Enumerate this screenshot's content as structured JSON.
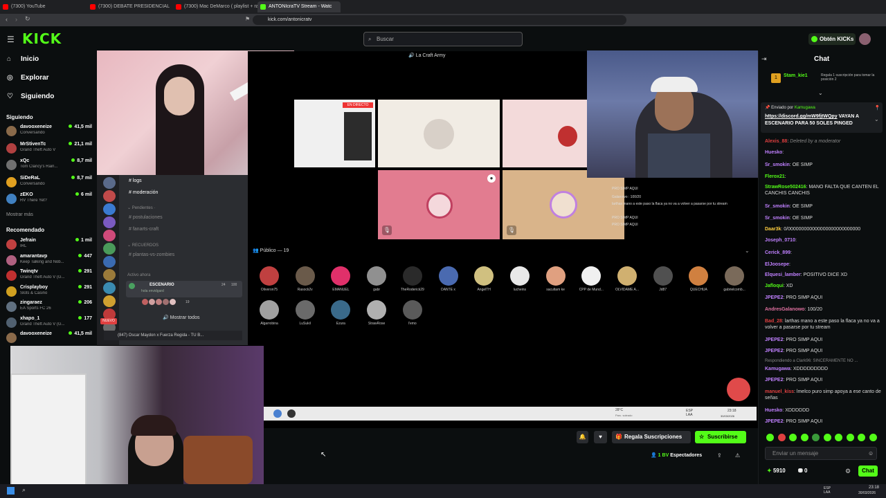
{
  "browser": {
    "tabs": [
      {
        "title": "(7300) YouTube",
        "color": "#ff0000"
      },
      {
        "title": "(7300) DEBATE PRESIDENCIAL 2026",
        "color": "#ff0000"
      },
      {
        "title": "(7300) Mac DeMarco ( playlist + rain",
        "color": "#ff0000"
      },
      {
        "title": "ANTONIcraTV Stream - Watc",
        "color": "#53fc18",
        "active": true
      }
    ],
    "url": "kick.com/antonicratv"
  },
  "site": {
    "logo": "KICK",
    "search_placeholder": "Buscar",
    "get_kicks": "Obtén KICKs"
  },
  "nav": [
    {
      "label": "Inicio",
      "icon": "home-icon"
    },
    {
      "label": "Explorar",
      "icon": "compass-icon"
    },
    {
      "label": "Siguiendo",
      "icon": "heart-icon"
    }
  ],
  "following_title": "Siguiendo",
  "following": [
    {
      "name": "davooxeneize",
      "game": "Conversando",
      "viewers": "41,5 mil",
      "color": "#8a6a4a"
    },
    {
      "name": "MrStivenTc",
      "game": "Grand Theft Auto V",
      "viewers": "21,1 mil",
      "color": "#b04040"
    },
    {
      "name": "xQc",
      "game": "Tom Clancy's Rain...",
      "viewers": "8,7 mil",
      "color": "#707070"
    },
    {
      "name": "SiDeRaL",
      "game": "Conversando",
      "viewers": "8,7 mil",
      "color": "#e0a020"
    },
    {
      "name": "zEKO",
      "game": "RV There Yet?",
      "viewers": "6 mil",
      "color": "#4080c0"
    }
  ],
  "show_more": "Mostrar más",
  "recommended_title": "Recomendado",
  "recommended": [
    {
      "name": "Jefrain",
      "game": "IRL",
      "viewers": "1 mil",
      "color": "#c04040"
    },
    {
      "name": "amarantavp",
      "game": "Keep Talking and Nob...",
      "viewers": "447",
      "color": "#b06080"
    },
    {
      "name": "Twinqtv",
      "game": "Grand Theft Auto V (G...",
      "viewers": "291",
      "color": "#c03030"
    },
    {
      "name": "Crisplayboy",
      "game": "Slots & Casino",
      "viewers": "291",
      "color": "#d0a020"
    },
    {
      "name": "zingaraez",
      "game": "EA Sports FC 26",
      "viewers": "206",
      "color": "#607080"
    },
    {
      "name": "xhapo_1",
      "game": "Grand Theft Auto V (G...",
      "viewers": "177",
      "color": "#506070"
    },
    {
      "name": "davooxeneize",
      "game": "",
      "viewers": "41,5 mil",
      "color": "#8a6a4a"
    }
  ],
  "discord": {
    "server_title": "La Craft Army",
    "channels": [
      "logs",
      "moderación",
      "postulaciones",
      "fanarts-craft",
      "plantas-vs-zombies"
    ],
    "category_pending": "Pendientes",
    "category_recuerdos": "RECUERDOS",
    "active_now": "Activo ahora",
    "stage_name": "ESCENARIO",
    "stage_sub": "hola envidgard",
    "stage_count1": "24",
    "stage_count2": "100",
    "stage_listeners": "19",
    "show_all": "Mostrar todos",
    "now_playing": "(847) Oscar Maydon x Fuerza Regida - TU B...",
    "live_badge": "EN DIRECTO",
    "audience_label": "Público — 19",
    "audience": [
      "Oliveron75",
      "Rasock2v",
      "EMANUEL",
      "gabr",
      "TheRoderick29",
      "DANTE x",
      "AngelTH",
      "lucheins",
      "sacultam ke",
      "CPP de Mund...",
      "OLVIDAME A...",
      "Jd87",
      "QUECHUA",
      "gabrielcomb...",
      "Algarrobina",
      "LuSukil",
      "Ezura",
      "StrawRose",
      "l'emo"
    ],
    "overlay_lines": [
      "PRO SIMP AQUI",
      "Galanowo : 100/20",
      "larthas mano a este paso la flaca ya no va a volver a pasarse por tu stream",
      "PRO SIMP AQUI",
      "PRO SIMP AQUI"
    ],
    "weather": "28°C",
    "weather_sub": "Parc. soleado",
    "lang": "ESP LAA",
    "clock_time": "23:18",
    "clock_date": "30/03/2026"
  },
  "actions": {
    "gift_subs": "Regala Suscripciones",
    "subscribe": "Suscribirse",
    "viewers_label": "Espectadores",
    "viewers_count": "1 BV"
  },
  "chat": {
    "title": "Chat",
    "pinned_user": "Stam_kie1",
    "pinned_msg": "Regala 1 suscripción para tomar la posición 2",
    "pinned_rank": "1",
    "announce_by": "Enviado por",
    "announce_user": "Kamugawa",
    "announce_link": "https://discord.gg/mW9fjtWQpy",
    "announce_text": "VAYAN A ESCENARIO PARA 50 SOLES PINGED",
    "messages": [
      {
        "user": "Alexis_88",
        "text": "Deleted by a moderator",
        "color": "#e04040"
      },
      {
        "user": "Huesko",
        "text": "",
        "color": "#c080ff"
      },
      {
        "user": "Sr_smokin",
        "text": "OE SIMP",
        "color": "#c080ff"
      },
      {
        "user": "Flerox21",
        "text": "",
        "color": "#53fc18"
      },
      {
        "user": "StrawRose502416",
        "text": "MANO FALTA QUE CANTEN EL CANCHIS CANCHIS",
        "color": "#53fc18"
      },
      {
        "user": "Sr_smokin",
        "text": "OE SIMP",
        "color": "#c080ff"
      },
      {
        "user": "Sr_smokin",
        "text": "OE SIMP",
        "color": "#c080ff"
      },
      {
        "user": "Daar3k",
        "text": "0/000000000000000000000000000",
        "color": "#ffd040"
      },
      {
        "user": "Joseph_0710",
        "text": "",
        "color": "#c080ff"
      },
      {
        "user": "Cerick_899",
        "text": "",
        "color": "#c080ff"
      },
      {
        "user": "ElJoosepe",
        "text": "",
        "color": "#c080ff"
      },
      {
        "user": "Elquesi_lamber",
        "text": "POSITIVO DICE XD",
        "color": "#c080ff"
      },
      {
        "user": "Jafloqui",
        "text": "XD",
        "color": "#53fc18"
      },
      {
        "user": "JPEPE2",
        "text": "PRO SIMP AQUI",
        "color": "#c080ff"
      },
      {
        "user": "AndresGalanowo",
        "text": "100/20",
        "color": "#e070a0"
      },
      {
        "user": "Bad_28",
        "text": "larthas mano a este paso la flaca ya no va a volver a pasarse por tu stream",
        "color": "#e04040"
      },
      {
        "user": "JPEPE2",
        "text": "PRO SIMP AQUI",
        "color": "#c080ff"
      },
      {
        "user": "JPEPE2",
        "text": "PRO SIMP AQUI",
        "color": "#c080ff"
      },
      {
        "user": "Kamugawa",
        "text": "XDDDDDDDDD",
        "color": "#c080ff"
      },
      {
        "user": "JPEPE2",
        "text": "PRO SIMP AQUI",
        "color": "#c080ff"
      },
      {
        "user": "manuel_kiss",
        "text": "lmelco puro simp apoya a ese canto de señas",
        "color": "#e04040"
      },
      {
        "user": "Huesko",
        "text": "XDDDDDD",
        "color": "#c080ff"
      },
      {
        "user": "JPEPE2",
        "text": "PRO SIMP AQUI",
        "color": "#c080ff"
      }
    ],
    "reply_note": "Respondiendo a Clark96: SINCERAMENTE NO ...",
    "input_placeholder": "Enviar un mensaje",
    "points": "5910",
    "subs_count": "0",
    "send_label": "Chat"
  },
  "taskbar": {
    "lang": "ESP LAA",
    "time": "23:18",
    "date": "30/03/2026"
  }
}
